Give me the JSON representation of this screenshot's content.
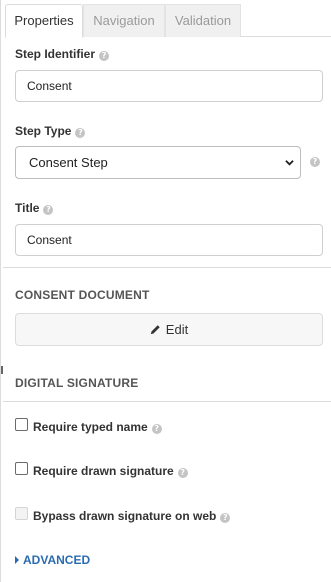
{
  "tabs": [
    {
      "label": "Properties",
      "active": true
    },
    {
      "label": "Navigation",
      "active": false
    },
    {
      "label": "Validation",
      "active": false
    }
  ],
  "step_identifier": {
    "label": "Step Identifier",
    "value": "Consent"
  },
  "step_type": {
    "label": "Step Type",
    "selected": "Consent Step"
  },
  "title_field": {
    "label": "Title",
    "value": "Consent"
  },
  "consent_document": {
    "heading": "CONSENT DOCUMENT",
    "edit_label": "Edit"
  },
  "digital_signature": {
    "heading": "DIGITAL SIGNATURE",
    "options": [
      {
        "label": "Require typed name",
        "checked": false,
        "disabled": false
      },
      {
        "label": "Require drawn signature",
        "checked": false,
        "disabled": false
      },
      {
        "label": "Bypass drawn signature on web",
        "checked": false,
        "disabled": true
      }
    ]
  },
  "advanced_label": "ADVANCED",
  "icons": {
    "help": "question-circle-icon",
    "edit": "pencil-icon",
    "select": "chevron-down-icon",
    "advanced": "caret-right-icon"
  },
  "colors": {
    "link": "#2b6cb0",
    "border": "#dcdcdc",
    "tab_inactive_bg": "#f0f0f0"
  }
}
